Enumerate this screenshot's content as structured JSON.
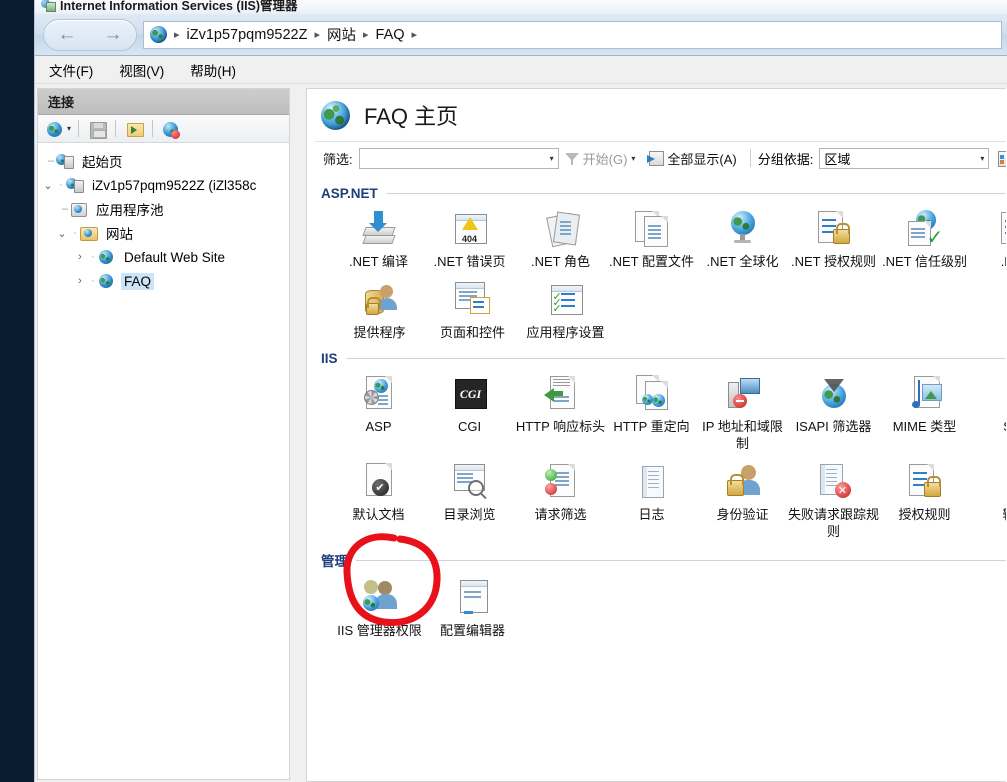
{
  "window": {
    "title": "Internet Information Services (IIS)管理器"
  },
  "nav": {
    "back_label": "←",
    "forward_label": "→",
    "breadcrumbs": [
      "iZv1p57pqm9522Z",
      "网站",
      "FAQ"
    ],
    "separator": "▸"
  },
  "menubar": {
    "items": [
      "文件(F)",
      "视图(V)",
      "帮助(H)"
    ]
  },
  "connections": {
    "header": "连接",
    "toolbar": [
      {
        "name": "connect-to-icon",
        "glyph": "globe"
      },
      {
        "name": "save-icon",
        "glyph": "save"
      },
      {
        "name": "connect-to-site-icon",
        "glyph": "folder"
      },
      {
        "name": "disconnect-icon",
        "glyph": "globe-x"
      }
    ],
    "tree": [
      {
        "label": "起始页",
        "icon": "start-page-icon",
        "twisty": "",
        "depth": 0,
        "selected": false
      },
      {
        "label": "iZv1p57pqm9522Z (iZl358c",
        "icon": "server-icon",
        "twisty": "⌄",
        "depth": 0,
        "selected": false
      },
      {
        "label": "应用程序池",
        "icon": "app-pools-icon",
        "twisty": "",
        "depth": 1,
        "selected": false
      },
      {
        "label": "网站",
        "icon": "sites-folder-icon",
        "twisty": "⌄",
        "depth": 1,
        "selected": false
      },
      {
        "label": "Default Web Site",
        "icon": "site-globe-icon",
        "twisty": "›",
        "depth": 2,
        "selected": false
      },
      {
        "label": "FAQ",
        "icon": "site-globe-icon",
        "twisty": "›",
        "depth": 2,
        "selected": true
      }
    ]
  },
  "page": {
    "title": "FAQ 主页"
  },
  "filterbar": {
    "filter_label": "筛选:",
    "filter_value": "",
    "go_label": "开始(G)",
    "show_all_label": "全部显示(A)",
    "group_by_label": "分组依据:",
    "group_by_value": "区域"
  },
  "groups": [
    {
      "name": "ASP.NET",
      "items": [
        {
          "label": ".NET 编译",
          "icon": "net-compilation-icon"
        },
        {
          "label": ".NET 错误页",
          "icon": "net-error-pages-icon"
        },
        {
          "label": ".NET 角色",
          "icon": "net-roles-icon"
        },
        {
          "label": ".NET 配置文件",
          "icon": "net-profile-icon"
        },
        {
          "label": ".NET 全球化",
          "icon": "net-globalization-icon"
        },
        {
          "label": ".NET 授权规则",
          "icon": "net-authorization-rules-icon"
        },
        {
          "label": ".NET 信任级别",
          "icon": "net-trust-levels-icon"
        },
        {
          "label": ".NET",
          "icon": "net-session-state-icon"
        },
        {
          "label": "提供程序",
          "icon": "providers-icon"
        },
        {
          "label": "页面和控件",
          "icon": "pages-and-controls-icon"
        },
        {
          "label": "应用程序设置",
          "icon": "application-settings-icon"
        }
      ]
    },
    {
      "name": "IIS",
      "items": [
        {
          "label": "ASP",
          "icon": "asp-icon"
        },
        {
          "label": "CGI",
          "icon": "cgi-icon"
        },
        {
          "label": "HTTP 响应标头",
          "icon": "http-response-headers-icon"
        },
        {
          "label": "HTTP 重定向",
          "icon": "http-redirect-icon"
        },
        {
          "label": "IP 地址和域限制",
          "icon": "ip-address-domain-restrictions-icon"
        },
        {
          "label": "ISAPI 筛选器",
          "icon": "isapi-filters-icon"
        },
        {
          "label": "MIME 类型",
          "icon": "mime-types-icon"
        },
        {
          "label": "SSL",
          "icon": "ssl-settings-icon"
        },
        {
          "label": "默认文档",
          "icon": "default-document-icon"
        },
        {
          "label": "目录浏览",
          "icon": "directory-browsing-icon"
        },
        {
          "label": "请求筛选",
          "icon": "request-filtering-icon"
        },
        {
          "label": "日志",
          "icon": "logging-icon"
        },
        {
          "label": "身份验证",
          "icon": "authentication-icon"
        },
        {
          "label": "失败请求跟踪规则",
          "icon": "failed-request-tracing-rules-icon"
        },
        {
          "label": "授权规则",
          "icon": "authorization-rules-icon"
        },
        {
          "label": "输出",
          "icon": "output-caching-icon"
        }
      ]
    },
    {
      "name": "管理",
      "items": [
        {
          "label": "IIS 管理器权限",
          "icon": "iis-manager-permissions-icon"
        },
        {
          "label": "配置编辑器",
          "icon": "configuration-editor-icon"
        }
      ]
    }
  ],
  "annotation": {
    "name": "red-circle-highlight",
    "target": "默认文档",
    "color": "#e8111a"
  },
  "colors": {
    "desktop": "#0a1c30",
    "selection": "#cce4f7",
    "group_heading": "#1f3d7a",
    "annotation_red": "#e8111a"
  }
}
